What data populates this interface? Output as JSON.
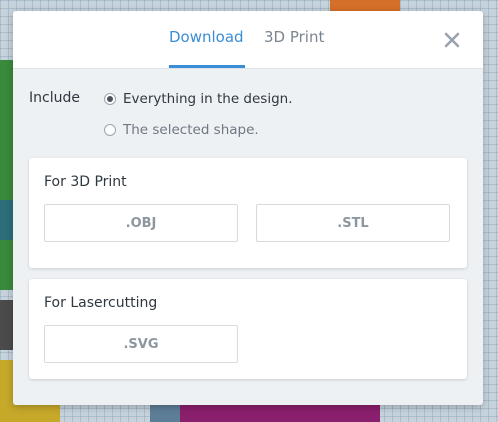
{
  "dialog": {
    "tabs": [
      {
        "label": "Download",
        "active": true
      },
      {
        "label": "3D Print",
        "active": false
      }
    ],
    "close_icon": "close-icon"
  },
  "include": {
    "label": "Include",
    "options": [
      {
        "label": "Everything in the design.",
        "selected": true
      },
      {
        "label": "The selected shape.",
        "selected": false
      }
    ]
  },
  "sections": [
    {
      "title": "For 3D Print",
      "buttons": [
        ".OBJ",
        ".STL"
      ]
    },
    {
      "title": "For Lasercutting",
      "buttons": [
        ".SVG"
      ]
    }
  ],
  "colors": {
    "accent": "#3a8dd6",
    "dialog_bg": "#eef1f4",
    "card_bg": "#ffffff",
    "text": "#2f3840",
    "muted": "#8d969f"
  }
}
